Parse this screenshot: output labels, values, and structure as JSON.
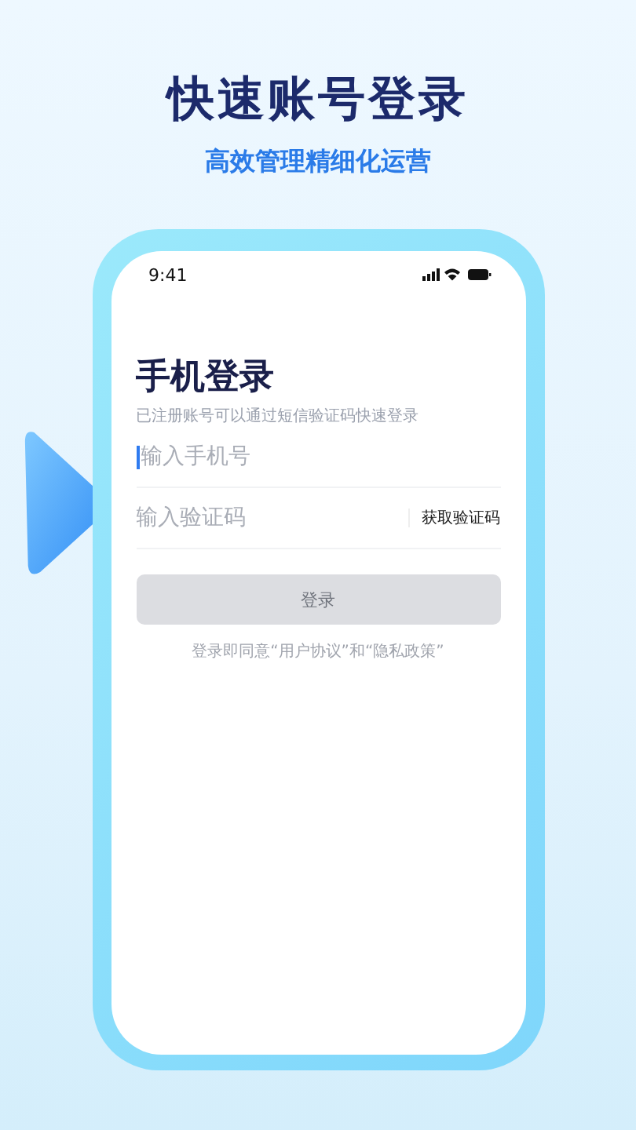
{
  "headline": "快速账号登录",
  "tagline": "高效管理精细化运营",
  "status_bar": {
    "time": "9:41"
  },
  "login": {
    "title": "手机登录",
    "subtitle": "已注册账号可以通过短信验证码快速登录",
    "phone_field": {
      "placeholder": "输入手机号",
      "focused": true
    },
    "code_field": {
      "placeholder": "输入验证码"
    },
    "get_code_button": "获取验证码",
    "submit_button": {
      "label": "登录",
      "disabled": true
    },
    "agreement": "登录即同意“用户协议”和“隐私政策”"
  }
}
